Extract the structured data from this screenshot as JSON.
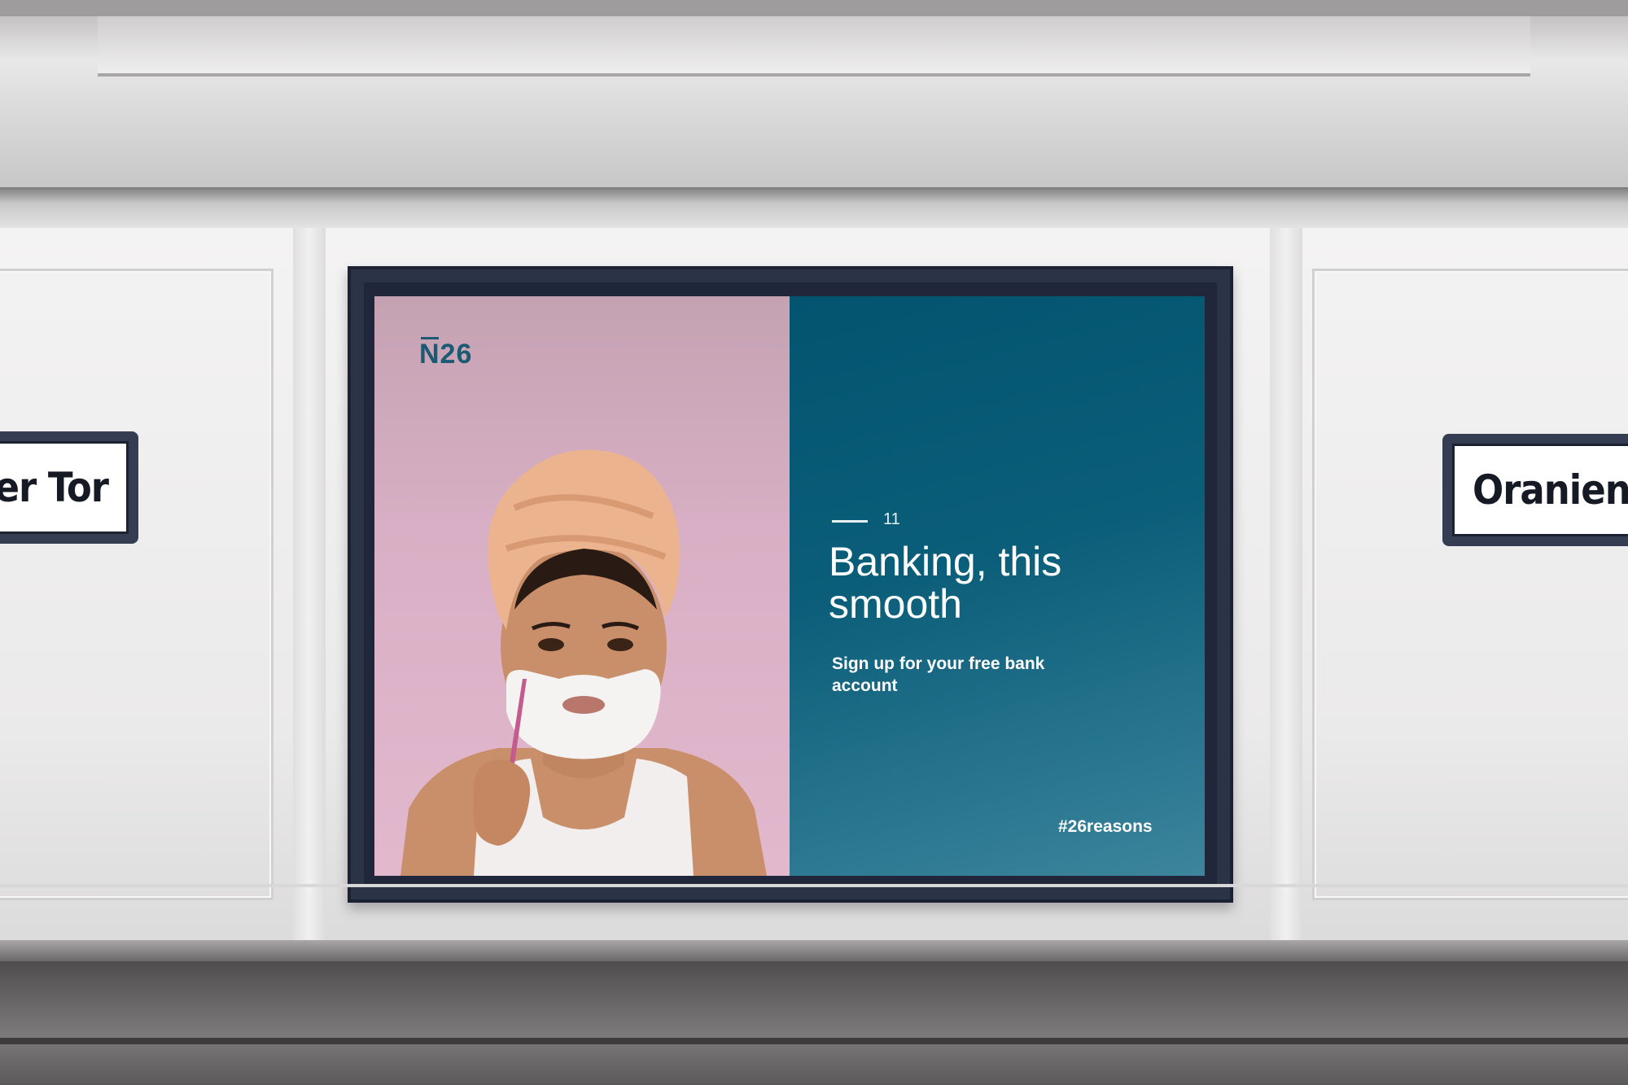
{
  "signs": {
    "left_text": "ger Tor",
    "right_text": "Oranienbu"
  },
  "poster": {
    "logo": "N26",
    "number": "11",
    "headline": "Banking, this smooth",
    "subline": "Sign up for your free bank account",
    "hashtag": "#26reasons"
  },
  "colors": {
    "poster_teal": "#02546f",
    "poster_pink": "#e2b8cd",
    "frame": "#2b3347"
  }
}
